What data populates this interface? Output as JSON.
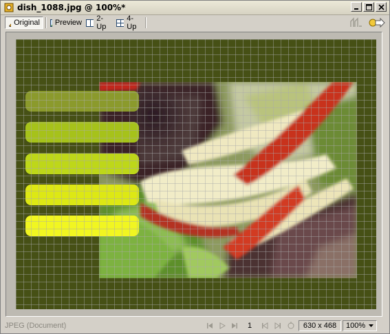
{
  "window": {
    "title": "dish_1088.jpg @ 100%*"
  },
  "toolbar": {
    "tabs": [
      {
        "label": "Original",
        "icon": "pencil-icon",
        "active": true
      },
      {
        "label": "Preview",
        "icon": "preview-image-icon",
        "active": false
      },
      {
        "label": "2-Up",
        "icon": "two-up-icon",
        "active": false
      },
      {
        "label": "4-Up",
        "icon": "four-up-icon",
        "active": false
      }
    ]
  },
  "canvas": {
    "background_color": "#465015",
    "pill_colors": [
      "#8b9a2c",
      "#a6c21a",
      "#bed719",
      "#dde814",
      "#f1f621"
    ]
  },
  "statusbar": {
    "doc_type": "JPEG (Document)",
    "frame": "1",
    "dimensions": "630 x 468",
    "zoom": "100%"
  }
}
